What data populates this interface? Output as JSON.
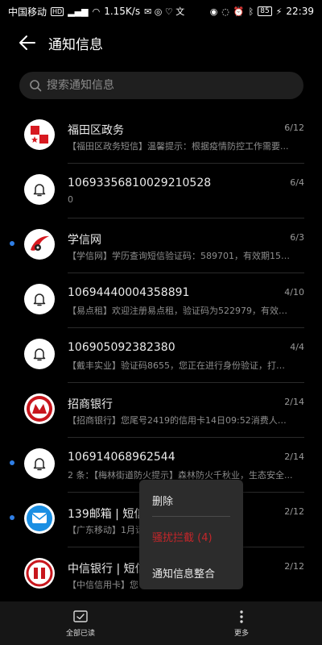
{
  "status_bar": {
    "carrier": "中国移动",
    "hd": "HD",
    "signal": "4G",
    "speed": "1.15K/s",
    "battery": "85",
    "time": "22:39"
  },
  "header": {
    "title": "通知信息"
  },
  "search": {
    "placeholder": "搜索通知信息"
  },
  "messages": [
    {
      "name": "福田区政务",
      "date": "6/12",
      "preview": "【福田区政务短信】温馨提示：根据疫情防控工作需要...",
      "unread": false,
      "avatar": "fudian"
    },
    {
      "name": "10693356810029210528",
      "date": "6/4",
      "preview": "0",
      "unread": false,
      "avatar": "bell"
    },
    {
      "name": "学信网",
      "date": "6/3",
      "preview": "【学信网】学历查询短信验证码：589701，有效期15分...",
      "unread": true,
      "avatar": "xuexin"
    },
    {
      "name": "10694440004358891",
      "date": "4/10",
      "preview": "【易点租】欢迎注册易点租，验证码为522979，有效时...",
      "unread": false,
      "avatar": "bell"
    },
    {
      "name": "106905092382380",
      "date": "4/4",
      "preview": "【戴丰实业】验证码8655，您正在进行身份验证，打死...",
      "unread": false,
      "avatar": "bell"
    },
    {
      "name": "招商银行",
      "date": "2/14",
      "preview": "【招商银行】您尾号2419的信用卡14日09:52消费人民币...",
      "unread": false,
      "avatar": "cmb"
    },
    {
      "name": "106914068962544",
      "date": "2/14",
      "preview": "2 条：【梅林街道防火提示】森林防火千秋业，生态安全...",
      "unread": true,
      "avatar": "bell"
    },
    {
      "name": "139邮箱 | 短信号",
      "date": "2/12",
      "preview": "【广东移动】1月话                              5.cn/t/kxgel...",
      "unread": true,
      "avatar": "139"
    },
    {
      "name": "中信银行 | 短信号",
      "date": "2/12",
      "preview": "【中信信用卡】您                              用卡，成功...",
      "unread": false,
      "avatar": "citic"
    }
  ],
  "popup_menu": {
    "delete": "删除",
    "block": "骚扰拦截 (4)",
    "merge": "通知信息整合"
  },
  "bottom_bar": {
    "mark_all_read": "全部已读",
    "more": "更多"
  },
  "colors": {
    "unread_dot": "#2f7fe6",
    "destructive": "#c4262a"
  }
}
